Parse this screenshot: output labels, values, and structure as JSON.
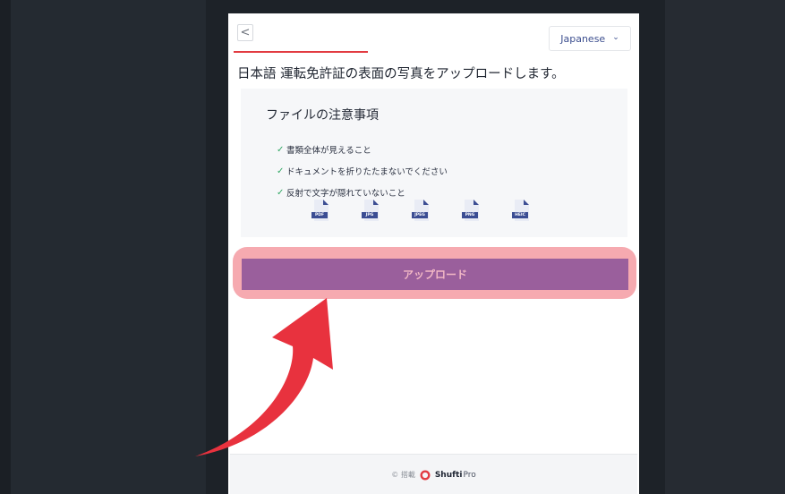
{
  "header": {
    "back_symbol": "<",
    "language": "Japanese"
  },
  "page": {
    "title": "日本語 運転免許証の表面の写真をアップロードします。"
  },
  "notes": {
    "heading": "ファイルの注意事項",
    "items": [
      "書類全体が見えること",
      "ドキュメントを折りたたまないでください",
      "反射で文字が隠れていないこと"
    ],
    "formats": [
      "PDF",
      "JPG",
      "JPEG",
      "PNG",
      "HEIC"
    ]
  },
  "upload": {
    "label": "アップロード"
  },
  "footer": {
    "powered_by": "© 搭載",
    "brand": "Shufti",
    "brand_suffix": "Pro"
  },
  "colors": {
    "accent_red": "#e23b41",
    "button_purple": "#9a5f9c",
    "highlight_pink": "#f6aab0",
    "arrow_red": "#e8323e",
    "check_green": "#33a866",
    "file_blue": "#3b4d93"
  }
}
